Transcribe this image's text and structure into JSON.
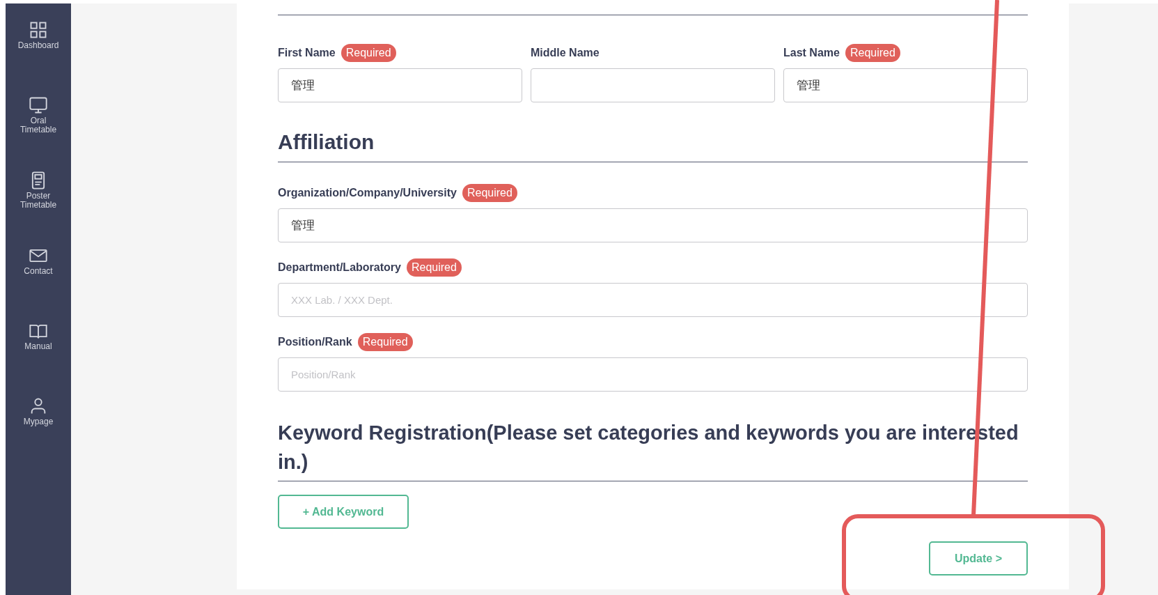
{
  "sidebar": {
    "items": [
      {
        "kind": "grid",
        "label": "Dashboard"
      },
      {
        "kind": "monitor",
        "label": "Oral\nTimetable"
      },
      {
        "kind": "poster",
        "label": "Poster\nTimetable"
      },
      {
        "kind": "mail",
        "label": "Contact"
      },
      {
        "kind": "book",
        "label": "Manual"
      },
      {
        "kind": "person",
        "label": "Mypage"
      }
    ]
  },
  "name_fields": [
    {
      "label": "First Name",
      "badge": "Required",
      "value": "管理"
    },
    {
      "label": "Middle Name"
    },
    {
      "label": "Last Name",
      "badge": "Required",
      "value": "管理"
    }
  ],
  "affiliation": {
    "heading": "Affiliation",
    "fields": [
      {
        "label": "Organization/Company/University",
        "badge": "Required",
        "value": "管理"
      },
      {
        "label": "Department/Laboratory",
        "badge": "Required",
        "placeholder": "XXX Lab. / XXX Dept."
      },
      {
        "label": "Position/Rank",
        "badge": "Required",
        "placeholder": "Position/Rank"
      }
    ]
  },
  "keywords": {
    "heading": "Keyword Registration(Please set categories and keywords you are interested in.)",
    "add_button": "+ Add Keyword"
  },
  "update_button": "Update >"
}
